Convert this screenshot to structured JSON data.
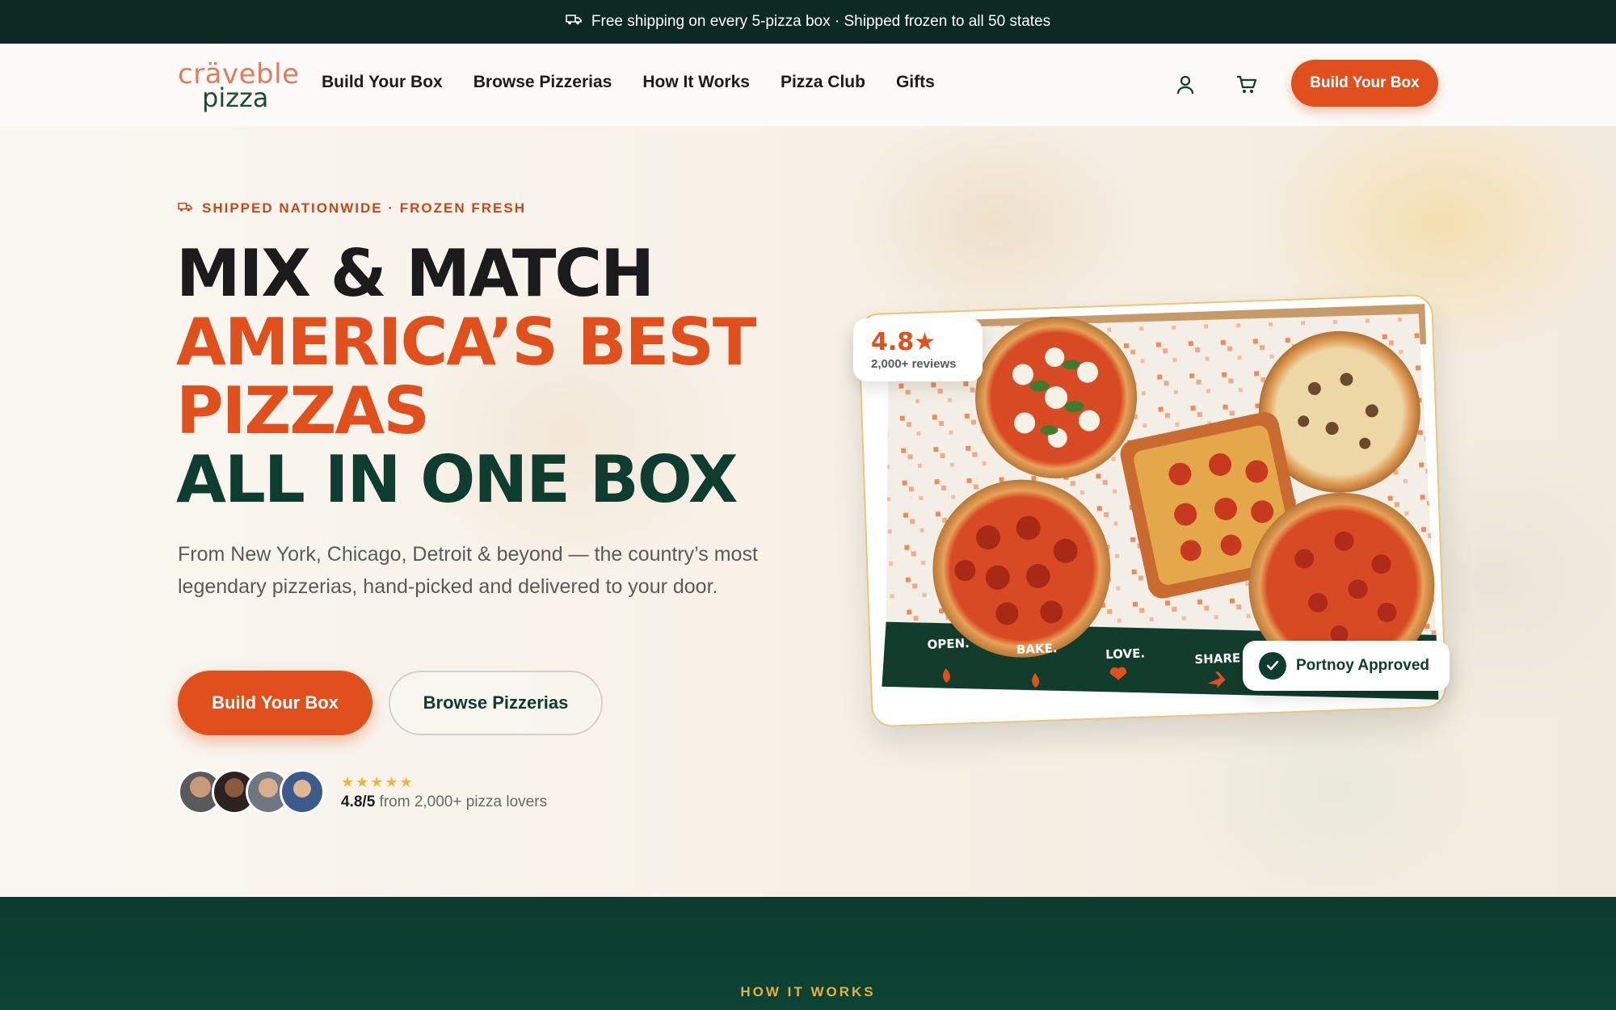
{
  "announcement": {
    "text": "Free shipping on every 5-pizza box · Shipped frozen to all 50 states",
    "icon": "truck-icon"
  },
  "header": {
    "logo": {
      "line1": "cräveble",
      "line2": "pizza"
    },
    "nav": [
      "Build Your Box",
      "Browse Pizzerias",
      "How It Works",
      "Pizza Club",
      "Gifts"
    ],
    "icons": [
      "account-icon",
      "cart-icon"
    ],
    "cta": "Build Your Box"
  },
  "hero": {
    "eyebrow": "SHIPPED NATIONWIDE · FROZEN FRESH",
    "headline": {
      "line1": "MIX & MATCH",
      "line2": "AMERICA’S BEST",
      "line3": "PIZZAS",
      "line4": "ALL IN ONE BOX"
    },
    "subcopy": "From New York, Chicago, Detroit & beyond — the country’s most legendary pizzerias, hand-picked and delivered to your door.",
    "primary_cta": "Build Your Box",
    "secondary_cta": "Browse Pizzerias",
    "social_proof": {
      "stars": "★★★★★",
      "rating": "4.8/5",
      "suffix": "from 2,000+ pizza lovers",
      "avatar_count": 4
    }
  },
  "product_card": {
    "rating_badge": {
      "value": "4.8★",
      "sub": "2,000+ reviews"
    },
    "approved_badge": "Portnoy Approved",
    "box_slogans": [
      "OPEN.",
      "BAKE.",
      "LOVE.",
      "SHARE"
    ]
  },
  "how_it_works": {
    "label": "HOW IT WORKS"
  },
  "colors": {
    "brand_orange": "#e0501c",
    "brand_green": "#0e3d2f",
    "dark_bar": "#0d2a22",
    "star_gold": "#f2b53a"
  }
}
